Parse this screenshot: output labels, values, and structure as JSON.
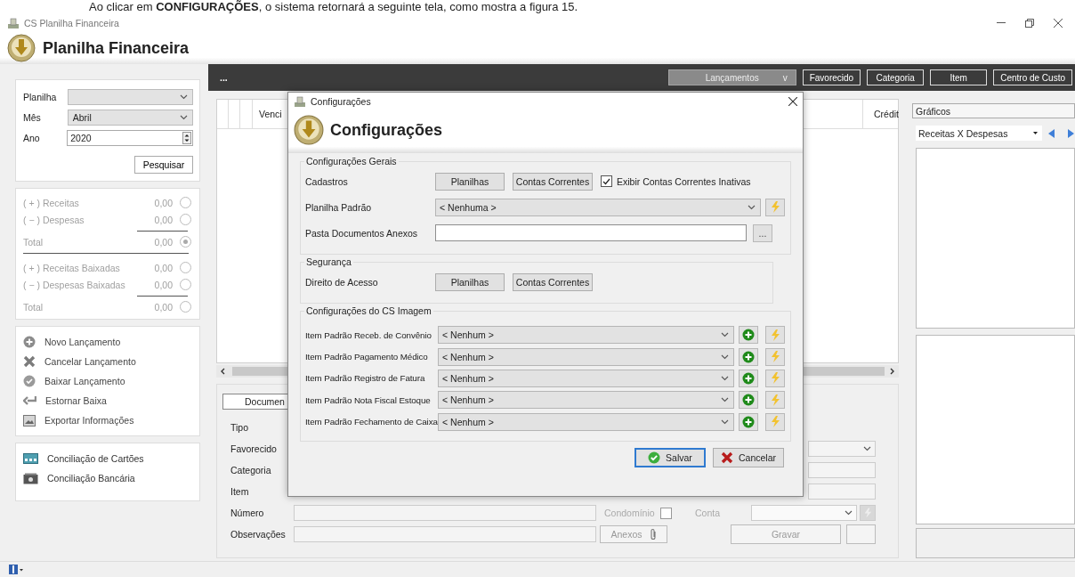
{
  "caption": "Ao clicar em **CONFIGURAÇÕES**, o sistema retornará a seguinte tela, como mostra a figura 15.",
  "window": {
    "title": "CS Planilha Financeira",
    "heading": "Planilha Financeira"
  },
  "filters": [
    {
      "label": "Planilha",
      "kind": "select"
    },
    {
      "label": "Mês",
      "kind": "select",
      "value": "Abril"
    },
    {
      "label": "Ano",
      "kind": "spin",
      "value": "2020"
    }
  ],
  "search_button": "Pesquisar",
  "totals": [
    {
      "rows": [
        {
          "label": "( + ) Receitas",
          "value": "0,00",
          "kind": "line",
          "selected": false
        },
        {
          "label": "( − ) Despesas",
          "value": "0,00",
          "kind": "line",
          "selected": false
        },
        {
          "label": "Total",
          "value": "0,00",
          "kind": "total",
          "selected": true
        }
      ]
    },
    {
      "rows": [
        {
          "label": "( + ) Receitas Baixadas",
          "value": "0,00",
          "kind": "line",
          "selected": false
        },
        {
          "label": "( − ) Despesas Baixadas",
          "value": "0,00",
          "kind": "line",
          "selected": false
        },
        {
          "label": "Total",
          "value": "0,00",
          "kind": "total",
          "selected": false
        }
      ]
    }
  ],
  "actions": [
    "Novo Lançamento",
    "Cancelar Lançamento",
    "Baixar Lançamento",
    "Estornar Baixa",
    "Exportar Informações"
  ],
  "conciliation": [
    "Conciliação de Cartões",
    "Conciliação Bancária"
  ],
  "toolbar": {
    "menu": "...",
    "buttons": [
      {
        "label": "Lançamentos",
        "caret": "v",
        "selected": true
      },
      {
        "label": "Favorecido",
        "selected": false
      },
      {
        "label": "Categoria",
        "selected": false
      },
      {
        "label": "Item",
        "selected": false
      },
      {
        "label": "Centro de Custo",
        "selected": false
      }
    ]
  },
  "grid": {
    "columns": [
      "Venci",
      "Crédit"
    ]
  },
  "details": {
    "tab": "Documen",
    "labels": [
      "Tipo",
      "Favorecido",
      "Categoria",
      "Item",
      "Número",
      "Observações"
    ],
    "condominio": {
      "label": "Condomínio",
      "checked": false
    },
    "conta_label": "Conta",
    "attach_button": "Anexos",
    "save_button": "Gravar"
  },
  "charts_panel": {
    "title": "Gráficos",
    "selector": "Receitas X Despesas"
  },
  "dialog": {
    "title": "Configurações",
    "heading": "Configurações",
    "groups": [
      {
        "title": "Configurações Gerais",
        "rows": [
          {
            "label": "Cadastros",
            "kind": "buttons",
            "buttons": [
              "Planilhas",
              "Contas Correntes"
            ],
            "checkbox": {
              "label": "Exibir Contas Correntes Inativas",
              "checked": true
            }
          },
          {
            "label": "Planilha Padrão",
            "kind": "select",
            "value": "< Nenhuma >"
          },
          {
            "label": "Pasta Documentos Anexos",
            "kind": "path",
            "button": "..."
          }
        ]
      },
      {
        "title": "Segurança",
        "rows": [
          {
            "label": "Direito de Acesso",
            "kind": "buttons",
            "buttons": [
              "Planilhas",
              "Contas Correntes"
            ]
          }
        ]
      },
      {
        "title": "Configurações do CS Imagem",
        "rows": [
          {
            "label": "Item Padrão Receb. de Convênio",
            "kind": "item_select",
            "value": "< Nenhum >"
          },
          {
            "label": "Item Padrão Pagamento Médico",
            "kind": "item_select",
            "value": "< Nenhum >"
          },
          {
            "label": "Item Padrão Registro de Fatura",
            "kind": "item_select",
            "value": "< Nenhum >"
          },
          {
            "label": "Item Padrão Nota Fiscal Estoque",
            "kind": "item_select",
            "value": "< Nenhum >"
          },
          {
            "label": "Item Padrão Fechamento de Caixa",
            "kind": "item_select",
            "value": "< Nenhum >"
          }
        ]
      }
    ],
    "save_button": "Salvar",
    "cancel_button": "Cancelar"
  }
}
